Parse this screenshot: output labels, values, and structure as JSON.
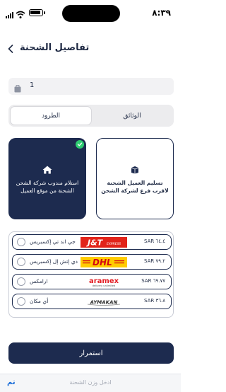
{
  "status_bar": {
    "time": "٨:٣٩"
  },
  "header": {
    "title": "تفاصيل الشحنة",
    "back_icon": "chevron-left-icon"
  },
  "quantity": {
    "value": "1",
    "icon": "package-icon"
  },
  "tabs": {
    "left_label": "الطرود",
    "right_label": "الوثائق",
    "selected": "left"
  },
  "delivery_options": {
    "courier_pickup": {
      "text": "استلام مندوب شركة الشحن الشحنة من موقع العميل",
      "icon": "home-icon",
      "selected": true
    },
    "branch_dropoff": {
      "text": "تسليم العميل الشحنة لاقرب فرع لشركة الشحن",
      "icon": "box-icon",
      "selected": false
    }
  },
  "carriers": [
    {
      "name": "جي اند تي إكسبريس",
      "logo": "J&T EXPRESS",
      "price": "SAR ٦٤.٤"
    },
    {
      "name": "دي إتش إل إكسبريس",
      "logo": "DHL",
      "price": "SAR ٧٩.٢"
    },
    {
      "name": "ارامكس",
      "logo": "aramex",
      "logo_sub": "delivery unlimited",
      "price": "SAR ٦٩.٧٧"
    },
    {
      "name": "أي مكان",
      "logo": "AYMAKAN",
      "price": "SAR ٣٦.٨"
    }
  ],
  "continue_button": {
    "label": "استمرار"
  },
  "keyboard_bar": {
    "done_label": "تم",
    "placeholder": "ادخل وزن الشحنة"
  },
  "colors": {
    "primary": "#1d2b4f",
    "check": "#2ecc71",
    "jt_red": "#e2231a",
    "dhl_yellow": "#ffcc00",
    "dhl_red": "#d40511",
    "aramex_red": "#e31e24",
    "link_blue": "#1d6fd8"
  }
}
